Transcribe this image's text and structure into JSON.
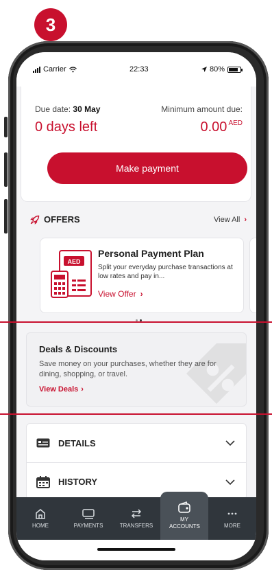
{
  "step_number": "3",
  "status_bar": {
    "carrier": "Carrier",
    "time": "22:33",
    "battery": "80%"
  },
  "due_card": {
    "due_date_label": "Due date:",
    "due_date_value": "30 May",
    "min_amount_label": "Minimum amount due:",
    "days_left": "0 days left",
    "amount": "0.00",
    "currency": "AED",
    "pay_button": "Make payment"
  },
  "offers": {
    "title": "OFFERS",
    "view_all": "View All",
    "card": {
      "title": "Personal Payment Plan",
      "description": "Split your everyday purchase transactions at low rates and pay in...",
      "link": "View Offer",
      "illustration_text": "AED"
    },
    "pager": {
      "count": 2,
      "active": 1
    }
  },
  "deals": {
    "title": "Deals & Discounts",
    "description": "Save money on your purchases, whether they are for dining, shopping, or travel.",
    "link": "View Deals"
  },
  "accordion": {
    "details": "DETAILS",
    "history": "HISTORY"
  },
  "tabbar": [
    {
      "label": "HOME",
      "icon": "home-icon"
    },
    {
      "label": "PAYMENTS",
      "icon": "payments-icon"
    },
    {
      "label": "TRANSFERS",
      "icon": "transfers-icon"
    },
    {
      "label": "MY ACCOUNTS",
      "icon": "wallet-icon",
      "active": true
    },
    {
      "label": "MORE",
      "icon": "more-icon"
    }
  ],
  "colors": {
    "accent": "#c8102e",
    "tabbar": "#30363c",
    "screen_bg": "#f4f4f6"
  }
}
